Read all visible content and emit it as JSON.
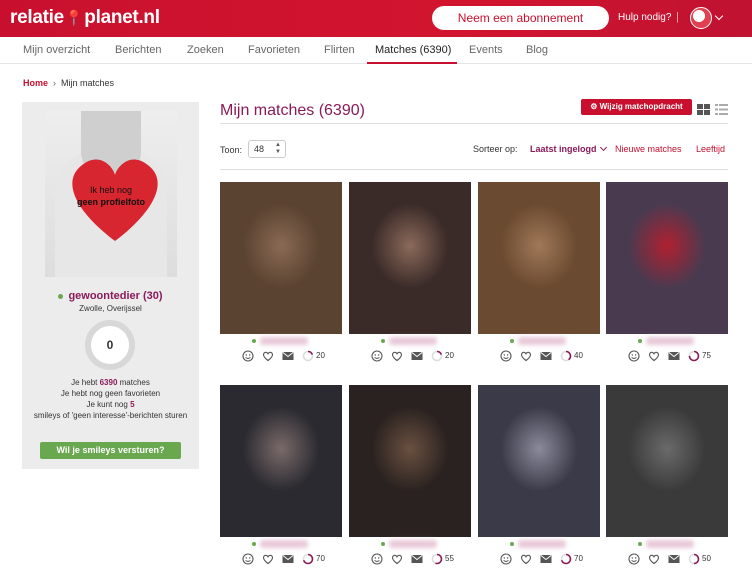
{
  "header": {
    "logo_left": "relatie",
    "logo_right": "planet.nl",
    "subscribe_label": "Neem een abonnement",
    "help_label": "Hulp nodig?",
    "separator": "|"
  },
  "nav": {
    "items": [
      {
        "label": "Mijn overzicht"
      },
      {
        "label": "Berichten"
      },
      {
        "label": "Zoeken"
      },
      {
        "label": "Favorieten"
      },
      {
        "label": "Flirten"
      },
      {
        "label": "Matches (6390)",
        "active": true
      },
      {
        "label": "Events"
      },
      {
        "label": "Blog"
      }
    ]
  },
  "breadcrumb": {
    "home": "Home",
    "current": "Mijn matches"
  },
  "sidebar": {
    "photo_line1": "Ik heb nog",
    "photo_line2": "geen profielfoto",
    "username": "gewoontedier (30)",
    "location": "Zwolle, Overijssel",
    "ring_value": "0",
    "stat_prefix": "Je hebt",
    "match_count": "6390",
    "stat_suffix": "matches",
    "favorites_text": "Je hebt nog geen favorieten",
    "smileys_prefix": "Je kunt nog",
    "smileys_count": "5",
    "smileys_text": "smileys of 'geen interesse'-berichten sturen",
    "cta_label": "Wil je smileys versturen?"
  },
  "main": {
    "title": "Mijn matches (6390)",
    "edit_button": "Wijzig matchopdracht",
    "toon_label": "Toon:",
    "toon_value": "48",
    "sort_label": "Sorteer op:",
    "sort_active": "Laatst ingelogd",
    "sort_new": "Nieuwe matches",
    "sort_age": "Leeftijd"
  },
  "matches": [
    {
      "score": "20",
      "colors": [
        "#5a4330",
        "#8a6a55"
      ]
    },
    {
      "score": "20",
      "colors": [
        "#3a2a28",
        "#8b6a5a"
      ]
    },
    {
      "score": "40",
      "colors": [
        "#6a4a30",
        "#a07858"
      ]
    },
    {
      "score": "75",
      "colors": [
        "#4a3a50",
        "#b02030"
      ]
    },
    {
      "score": "70",
      "colors": [
        "#2a2a30",
        "#7a6a6a"
      ]
    },
    {
      "score": "55",
      "colors": [
        "#2a2220",
        "#6a5040"
      ]
    },
    {
      "score": "70",
      "colors": [
        "#3a3a48",
        "#8a8a9a"
      ]
    },
    {
      "score": "50",
      "colors": [
        "#3a3a3a",
        "#6a6a6a"
      ]
    }
  ],
  "icon_names": [
    "smiley-icon",
    "heart-icon",
    "envelope-icon",
    "match-score-icon"
  ]
}
